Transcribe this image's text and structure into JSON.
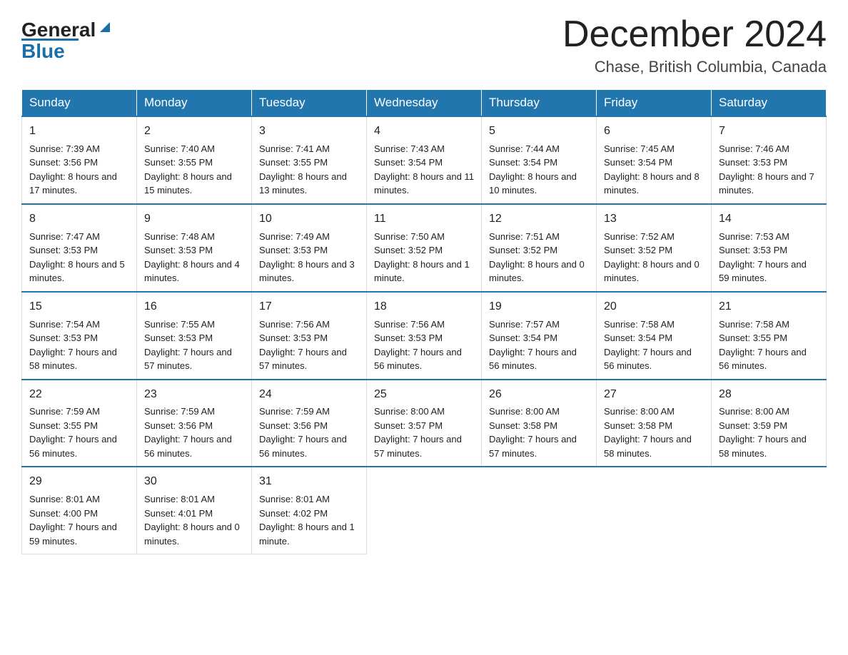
{
  "logo": {
    "general": "General",
    "blue": "Blue"
  },
  "header": {
    "month": "December 2024",
    "location": "Chase, British Columbia, Canada"
  },
  "days": [
    "Sunday",
    "Monday",
    "Tuesday",
    "Wednesday",
    "Thursday",
    "Friday",
    "Saturday"
  ],
  "weeks": [
    [
      {
        "num": "1",
        "sunrise": "7:39 AM",
        "sunset": "3:56 PM",
        "daylight": "8 hours and 17 minutes."
      },
      {
        "num": "2",
        "sunrise": "7:40 AM",
        "sunset": "3:55 PM",
        "daylight": "8 hours and 15 minutes."
      },
      {
        "num": "3",
        "sunrise": "7:41 AM",
        "sunset": "3:55 PM",
        "daylight": "8 hours and 13 minutes."
      },
      {
        "num": "4",
        "sunrise": "7:43 AM",
        "sunset": "3:54 PM",
        "daylight": "8 hours and 11 minutes."
      },
      {
        "num": "5",
        "sunrise": "7:44 AM",
        "sunset": "3:54 PM",
        "daylight": "8 hours and 10 minutes."
      },
      {
        "num": "6",
        "sunrise": "7:45 AM",
        "sunset": "3:54 PM",
        "daylight": "8 hours and 8 minutes."
      },
      {
        "num": "7",
        "sunrise": "7:46 AM",
        "sunset": "3:53 PM",
        "daylight": "8 hours and 7 minutes."
      }
    ],
    [
      {
        "num": "8",
        "sunrise": "7:47 AM",
        "sunset": "3:53 PM",
        "daylight": "8 hours and 5 minutes."
      },
      {
        "num": "9",
        "sunrise": "7:48 AM",
        "sunset": "3:53 PM",
        "daylight": "8 hours and 4 minutes."
      },
      {
        "num": "10",
        "sunrise": "7:49 AM",
        "sunset": "3:53 PM",
        "daylight": "8 hours and 3 minutes."
      },
      {
        "num": "11",
        "sunrise": "7:50 AM",
        "sunset": "3:52 PM",
        "daylight": "8 hours and 1 minute."
      },
      {
        "num": "12",
        "sunrise": "7:51 AM",
        "sunset": "3:52 PM",
        "daylight": "8 hours and 0 minutes."
      },
      {
        "num": "13",
        "sunrise": "7:52 AM",
        "sunset": "3:52 PM",
        "daylight": "8 hours and 0 minutes."
      },
      {
        "num": "14",
        "sunrise": "7:53 AM",
        "sunset": "3:53 PM",
        "daylight": "7 hours and 59 minutes."
      }
    ],
    [
      {
        "num": "15",
        "sunrise": "7:54 AM",
        "sunset": "3:53 PM",
        "daylight": "7 hours and 58 minutes."
      },
      {
        "num": "16",
        "sunrise": "7:55 AM",
        "sunset": "3:53 PM",
        "daylight": "7 hours and 57 minutes."
      },
      {
        "num": "17",
        "sunrise": "7:56 AM",
        "sunset": "3:53 PM",
        "daylight": "7 hours and 57 minutes."
      },
      {
        "num": "18",
        "sunrise": "7:56 AM",
        "sunset": "3:53 PM",
        "daylight": "7 hours and 56 minutes."
      },
      {
        "num": "19",
        "sunrise": "7:57 AM",
        "sunset": "3:54 PM",
        "daylight": "7 hours and 56 minutes."
      },
      {
        "num": "20",
        "sunrise": "7:58 AM",
        "sunset": "3:54 PM",
        "daylight": "7 hours and 56 minutes."
      },
      {
        "num": "21",
        "sunrise": "7:58 AM",
        "sunset": "3:55 PM",
        "daylight": "7 hours and 56 minutes."
      }
    ],
    [
      {
        "num": "22",
        "sunrise": "7:59 AM",
        "sunset": "3:55 PM",
        "daylight": "7 hours and 56 minutes."
      },
      {
        "num": "23",
        "sunrise": "7:59 AM",
        "sunset": "3:56 PM",
        "daylight": "7 hours and 56 minutes."
      },
      {
        "num": "24",
        "sunrise": "7:59 AM",
        "sunset": "3:56 PM",
        "daylight": "7 hours and 56 minutes."
      },
      {
        "num": "25",
        "sunrise": "8:00 AM",
        "sunset": "3:57 PM",
        "daylight": "7 hours and 57 minutes."
      },
      {
        "num": "26",
        "sunrise": "8:00 AM",
        "sunset": "3:58 PM",
        "daylight": "7 hours and 57 minutes."
      },
      {
        "num": "27",
        "sunrise": "8:00 AM",
        "sunset": "3:58 PM",
        "daylight": "7 hours and 58 minutes."
      },
      {
        "num": "28",
        "sunrise": "8:00 AM",
        "sunset": "3:59 PM",
        "daylight": "7 hours and 58 minutes."
      }
    ],
    [
      {
        "num": "29",
        "sunrise": "8:01 AM",
        "sunset": "4:00 PM",
        "daylight": "7 hours and 59 minutes."
      },
      {
        "num": "30",
        "sunrise": "8:01 AM",
        "sunset": "4:01 PM",
        "daylight": "8 hours and 0 minutes."
      },
      {
        "num": "31",
        "sunrise": "8:01 AM",
        "sunset": "4:02 PM",
        "daylight": "8 hours and 1 minute."
      },
      null,
      null,
      null,
      null
    ]
  ]
}
